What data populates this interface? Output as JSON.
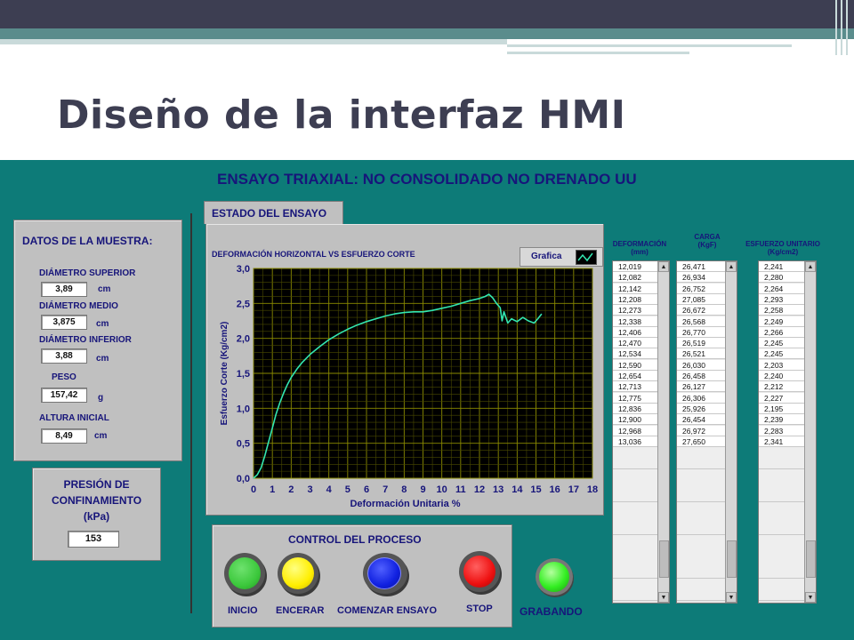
{
  "slide": {
    "title": "Diseño de la interfaz HMI"
  },
  "app": {
    "title": "ENSAYO TRIAXIAL: NO CONSOLIDADO NO DRENADO UU",
    "tab_label": "ESTADO DEL ENSAYO",
    "sample": {
      "title": "DATOS DE LA MUESTRA:",
      "fields": [
        {
          "label": "DIÁMETRO SUPERIOR",
          "value": "3,89",
          "unit": "cm"
        },
        {
          "label": "DIÁMETRO MEDIO",
          "value": "3,875",
          "unit": "cm"
        },
        {
          "label": "DIÁMETRO INFERIOR",
          "value": "3,88",
          "unit": "cm"
        },
        {
          "label": "PESO",
          "value": "157,42",
          "unit": "g"
        },
        {
          "label": "ALTURA INICIAL",
          "value": "8,49",
          "unit": "cm"
        }
      ]
    },
    "pressure": {
      "label_line1": "PRESIÓN DE",
      "label_line2": "CONFINAMIENTO",
      "label_line3": "(kPa)",
      "value": "153"
    },
    "chart_panel": {
      "title": "DEFORMACIÓN HORIZONTAL VS ESFUERZO CORTE",
      "legend": "Grafica"
    },
    "tables": {
      "deformacion": {
        "title_line1": "DEFORMACIÓN",
        "title_line2": "(mm)",
        "values": [
          "12,019",
          "12,082",
          "12,142",
          "12,208",
          "12,273",
          "12,338",
          "12,406",
          "12,470",
          "12,534",
          "12,590",
          "12,654",
          "12,713",
          "12,775",
          "12,836",
          "12,900",
          "12,968",
          "13,036"
        ]
      },
      "carga": {
        "title_line1": "CARGA",
        "title_line2": "(KgF)",
        "values": [
          "26,471",
          "26,934",
          "26,752",
          "27,085",
          "26,672",
          "26,568",
          "26,770",
          "26,519",
          "26,521",
          "26,030",
          "26,458",
          "26,127",
          "26,306",
          "25,926",
          "26,454",
          "26,972",
          "27,650"
        ]
      },
      "esfuerzo": {
        "title_line1": "ESFUERZO UNITARIO",
        "title_line2": "(Kg/cm2)",
        "values": [
          "2,241",
          "2,280",
          "2,264",
          "2,293",
          "2,258",
          "2,249",
          "2,266",
          "2,245",
          "2,245",
          "2,203",
          "2,240",
          "2,212",
          "2,227",
          "2,195",
          "2,239",
          "2,283",
          "2,341"
        ]
      }
    },
    "control": {
      "title": "CONTROL DEL PROCESO",
      "buttons": [
        {
          "label": "INICIO",
          "color": "#3cc83c"
        },
        {
          "label": "ENCERAR",
          "color": "#ffee00"
        },
        {
          "label": "COMENZAR ENSAYO",
          "color": "#1020e0"
        },
        {
          "label": "STOP",
          "color": "#ee1010"
        }
      ]
    },
    "recording": {
      "label": "GRABANDO",
      "color": "#33ee22"
    }
  },
  "chart_data": {
    "type": "line",
    "xlabel": "Deformación Unitaria %",
    "ylabel": "Esfuerzo Corte (Kg/cm2)",
    "xlim": [
      0,
      18
    ],
    "ylim": [
      0,
      3
    ],
    "x_ticks": [
      "0",
      "1",
      "2",
      "3",
      "4",
      "5",
      "6",
      "7",
      "8",
      "9",
      "10",
      "11",
      "12",
      "13",
      "14",
      "15",
      "16",
      "17",
      "18"
    ],
    "y_ticks": [
      "0,0",
      "0,5",
      "1,0",
      "1,5",
      "2,0",
      "2,5",
      "3,0"
    ],
    "grid": true,
    "line_color": "#33e6b0",
    "series": [
      {
        "x": [
          0,
          0.2,
          0.4,
          0.6,
          0.8,
          1.0,
          1.2,
          1.4,
          1.6,
          1.8,
          2.0,
          2.3,
          2.6,
          3.0,
          3.5,
          4.0,
          4.5,
          5.0,
          5.5,
          6.0,
          6.5,
          7.0,
          7.5,
          8.0,
          8.5,
          9.0,
          9.5,
          10.0,
          10.5,
          11.0,
          11.5,
          12.0,
          12.3,
          12.5,
          12.7,
          12.9,
          13.1,
          13.2,
          13.3,
          13.5,
          13.7,
          14.0,
          14.3,
          14.6,
          14.9,
          15.1,
          15.3
        ],
        "y": [
          0,
          0.05,
          0.15,
          0.32,
          0.52,
          0.72,
          0.92,
          1.08,
          1.22,
          1.34,
          1.44,
          1.56,
          1.66,
          1.77,
          1.88,
          1.98,
          2.06,
          2.13,
          2.19,
          2.24,
          2.28,
          2.32,
          2.35,
          2.37,
          2.38,
          2.38,
          2.4,
          2.43,
          2.46,
          2.5,
          2.54,
          2.57,
          2.6,
          2.63,
          2.58,
          2.5,
          2.44,
          2.25,
          2.38,
          2.22,
          2.28,
          2.24,
          2.3,
          2.25,
          2.22,
          2.28,
          2.35
        ]
      }
    ]
  }
}
